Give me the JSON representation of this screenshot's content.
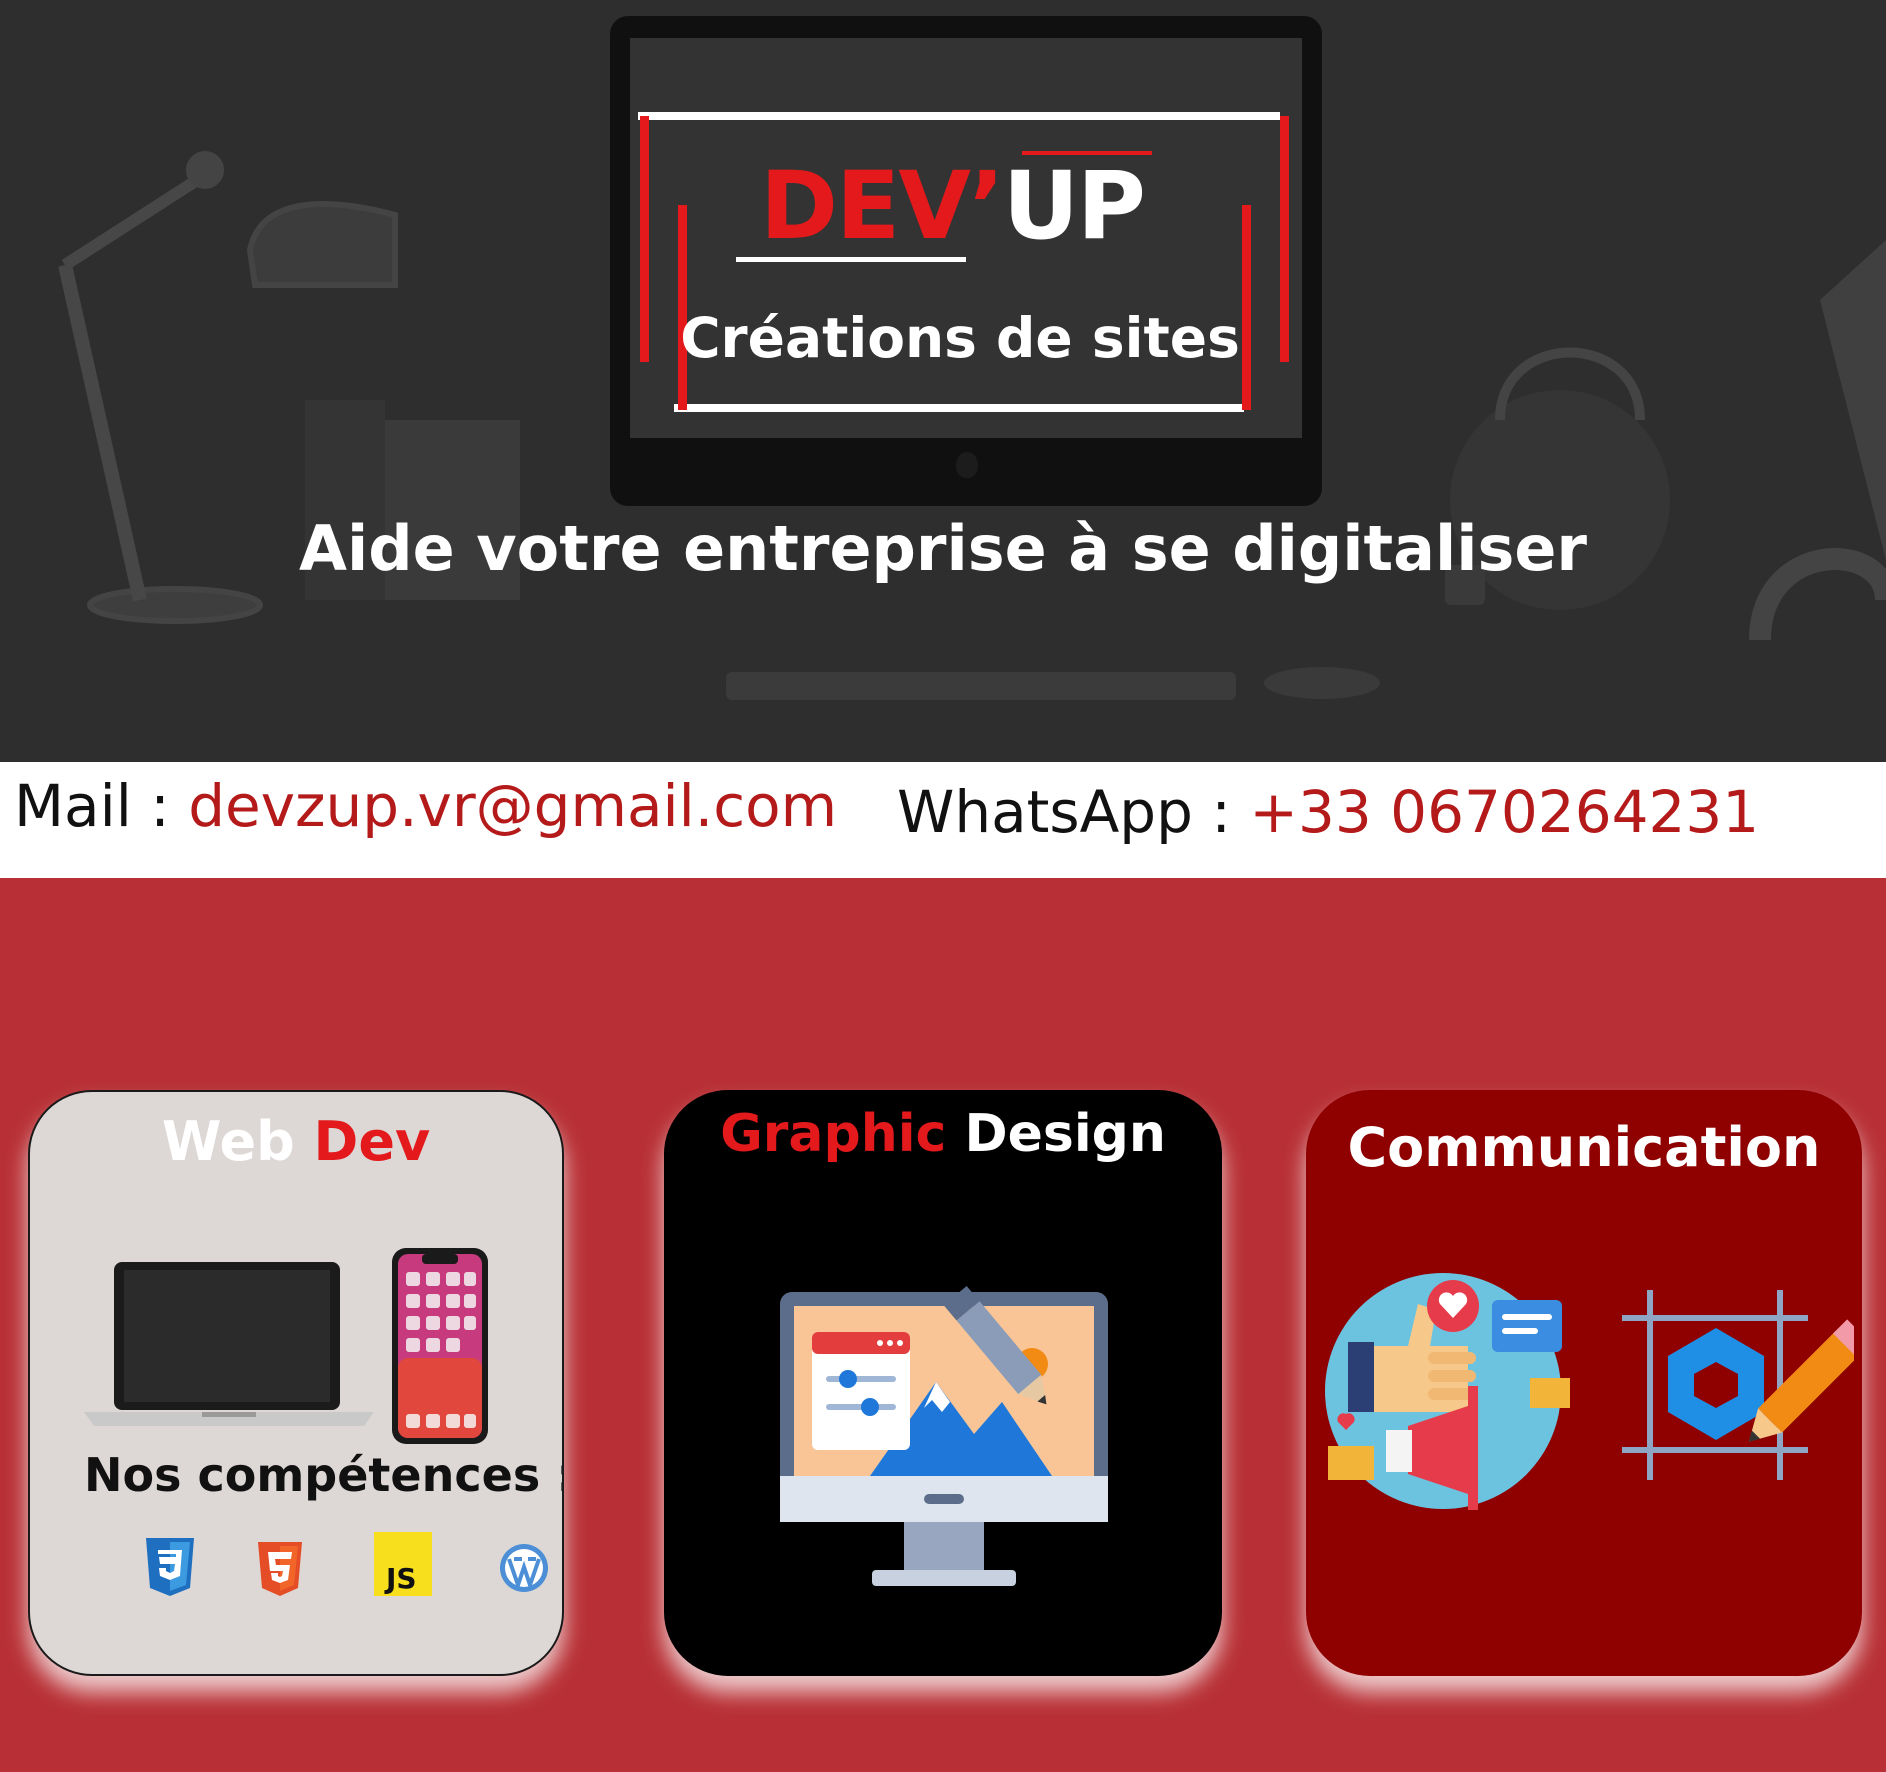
{
  "hero": {
    "brand_first": "DEV",
    "brand_second": "UP",
    "brand_tagline": "Créations de sites",
    "subtitle": "Aide votre entreprise à se digitaliser"
  },
  "contact": {
    "mail_label": "Mail : ",
    "mail_value": "devzup.vr@gmail.com",
    "whatsapp_label": "WhatsApp : ",
    "whatsapp_value": "+33 0670264231"
  },
  "cards": {
    "web": {
      "title_first": "Web ",
      "title_second": "Dev",
      "skills_label": "Nos compétences :"
    },
    "graphic": {
      "title_first": "Graphic",
      "title_second": " Design"
    },
    "communication": {
      "title": "Communication"
    }
  },
  "icons": [
    "desk-lamp-icon",
    "laptop-icon",
    "smartphone-icon",
    "css3-icon",
    "html5-icon",
    "javascript-icon",
    "wordpress-icon",
    "design-monitor-icon",
    "social-media-icon",
    "logo-design-icon"
  ],
  "colors": {
    "brand_red": "#e3191b",
    "page_red": "#b83035",
    "card_dark_red": "#8f0000",
    "link_red": "#b51a1a"
  }
}
